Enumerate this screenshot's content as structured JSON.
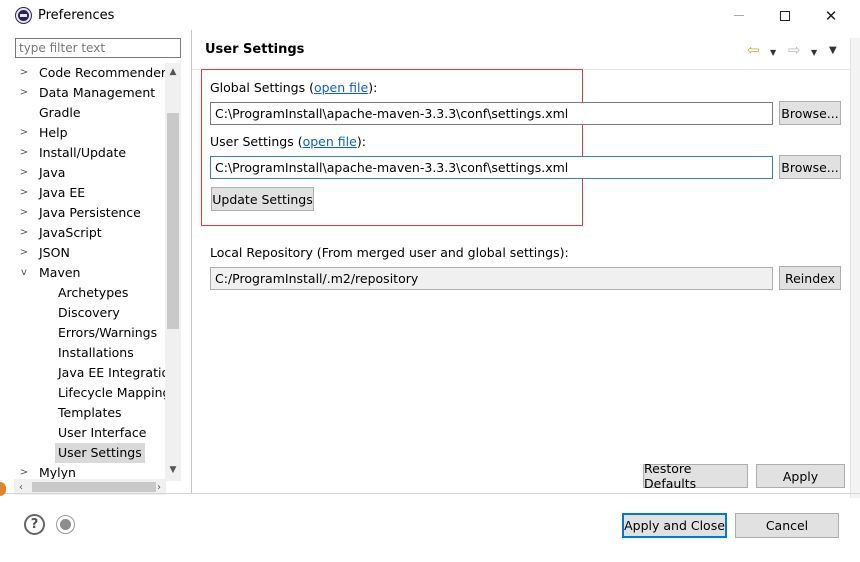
{
  "window": {
    "title": "Preferences",
    "minimize_icon": "minimize-icon",
    "maximize_icon": "maximize-icon",
    "close_icon": "close-icon",
    "close_glyph": "✕"
  },
  "sidebar": {
    "filter_placeholder": "type filter text",
    "expanded_glyph": "v",
    "collapsed_glyph": ">",
    "items": [
      {
        "label": "Code Recommenders",
        "expandable": true
      },
      {
        "label": "Data Management",
        "expandable": true
      },
      {
        "label": "Gradle",
        "expandable": false
      },
      {
        "label": "Help",
        "expandable": true
      },
      {
        "label": "Install/Update",
        "expandable": true
      },
      {
        "label": "Java",
        "expandable": true
      },
      {
        "label": "Java EE",
        "expandable": true
      },
      {
        "label": "Java Persistence",
        "expandable": true
      },
      {
        "label": "JavaScript",
        "expandable": true
      },
      {
        "label": "JSON",
        "expandable": true
      },
      {
        "label": "Maven",
        "expandable": true,
        "expanded": true
      },
      {
        "label": "Mylyn",
        "expandable": true
      }
    ],
    "maven_children": [
      {
        "label": "Archetypes"
      },
      {
        "label": "Discovery"
      },
      {
        "label": "Errors/Warnings"
      },
      {
        "label": "Installations"
      },
      {
        "label": "Java EE Integration"
      },
      {
        "label": "Lifecycle Mapping"
      },
      {
        "label": "Templates"
      },
      {
        "label": "User Interface"
      },
      {
        "label": "User Settings",
        "selected": true
      }
    ]
  },
  "header": {
    "title": "User Settings",
    "back_icon": "back-arrow-icon",
    "forward_icon": "forward-arrow-icon",
    "menu_icon": "view-menu-icon"
  },
  "main": {
    "global_settings_label": "Global Settings (",
    "global_settings_link": "open file",
    "global_settings_suffix": "):",
    "global_settings_value": "C:\\ProgramInstall\\apache-maven-3.3.3\\conf\\settings.xml",
    "user_settings_label": "User Settings (",
    "user_settings_link": "open file",
    "user_settings_suffix": "):",
    "user_settings_value": "C:\\ProgramInstall\\apache-maven-3.3.3\\conf\\settings.xml",
    "browse_label": "Browse...",
    "update_settings_label": "Update Settings",
    "local_repo_label": "Local Repository (From merged user and global settings):",
    "local_repo_value": "C:/ProgramInstall/.m2/repository",
    "reindex_label": "Reindex",
    "restore_defaults_label": "Restore Defaults",
    "apply_label": "Apply",
    "highlight_color": "#e03a3a",
    "link_color": "#0b63c4"
  },
  "footer": {
    "help_glyph": "?",
    "help_icon": "help-icon",
    "record_icon": "record-icon",
    "apply_close_label": "Apply and Close",
    "cancel_label": "Cancel"
  }
}
